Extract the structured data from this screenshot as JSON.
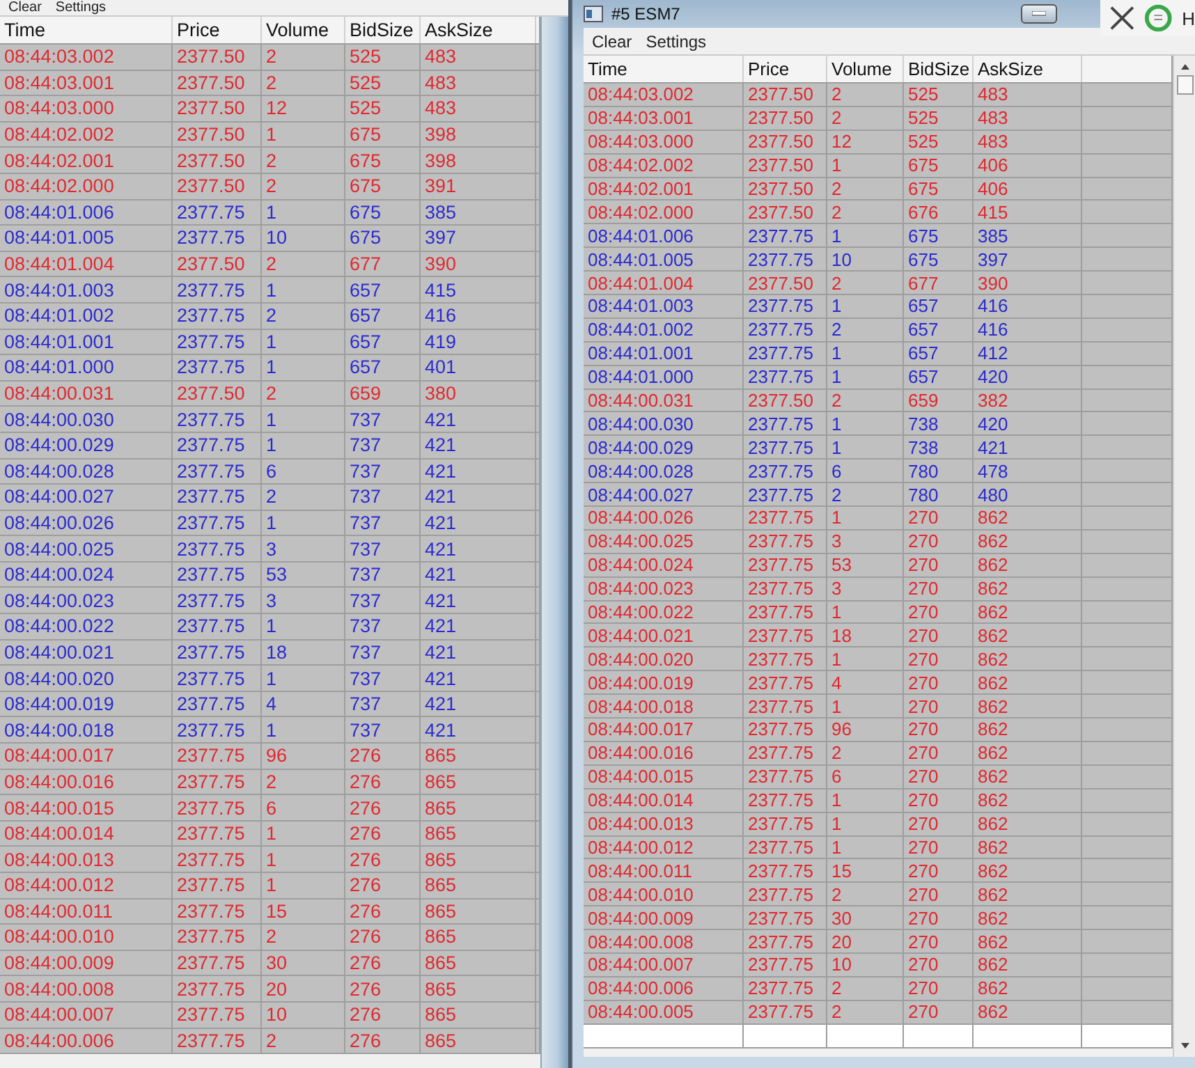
{
  "left_window": {
    "menu": [
      "Clear",
      "Settings"
    ],
    "columns": [
      "Time",
      "Price",
      "Volume",
      "BidSize",
      "AskSize"
    ],
    "rows": [
      {
        "cells": [
          "08:44:03.002",
          "2377.50",
          "2",
          "525",
          "483"
        ],
        "color": "#e0282e"
      },
      {
        "cells": [
          "08:44:03.001",
          "2377.50",
          "2",
          "525",
          "483"
        ],
        "color": "#e0282e"
      },
      {
        "cells": [
          "08:44:03.000",
          "2377.50",
          "12",
          "525",
          "483"
        ],
        "color": "#e0282e"
      },
      {
        "cells": [
          "08:44:02.002",
          "2377.50",
          "1",
          "675",
          "398"
        ],
        "color": "#e0282e"
      },
      {
        "cells": [
          "08:44:02.001",
          "2377.50",
          "2",
          "675",
          "398"
        ],
        "color": "#e0282e"
      },
      {
        "cells": [
          "08:44:02.000",
          "2377.50",
          "2",
          "675",
          "391"
        ],
        "color": "#e0282e"
      },
      {
        "cells": [
          "08:44:01.006",
          "2377.75",
          "1",
          "675",
          "385"
        ],
        "color": "#2a2ad0"
      },
      {
        "cells": [
          "08:44:01.005",
          "2377.75",
          "10",
          "675",
          "397"
        ],
        "color": "#2a2ad0"
      },
      {
        "cells": [
          "08:44:01.004",
          "2377.50",
          "2",
          "677",
          "390"
        ],
        "color": "#e0282e"
      },
      {
        "cells": [
          "08:44:01.003",
          "2377.75",
          "1",
          "657",
          "415"
        ],
        "color": "#2a2ad0"
      },
      {
        "cells": [
          "08:44:01.002",
          "2377.75",
          "2",
          "657",
          "416"
        ],
        "color": "#2a2ad0"
      },
      {
        "cells": [
          "08:44:01.001",
          "2377.75",
          "1",
          "657",
          "419"
        ],
        "color": "#2a2ad0"
      },
      {
        "cells": [
          "08:44:01.000",
          "2377.75",
          "1",
          "657",
          "401"
        ],
        "color": "#2a2ad0"
      },
      {
        "cells": [
          "08:44:00.031",
          "2377.50",
          "2",
          "659",
          "380"
        ],
        "color": "#e0282e"
      },
      {
        "cells": [
          "08:44:00.030",
          "2377.75",
          "1",
          "737",
          "421"
        ],
        "color": "#2a2ad0"
      },
      {
        "cells": [
          "08:44:00.029",
          "2377.75",
          "1",
          "737",
          "421"
        ],
        "color": "#2a2ad0"
      },
      {
        "cells": [
          "08:44:00.028",
          "2377.75",
          "6",
          "737",
          "421"
        ],
        "color": "#2a2ad0"
      },
      {
        "cells": [
          "08:44:00.027",
          "2377.75",
          "2",
          "737",
          "421"
        ],
        "color": "#2a2ad0"
      },
      {
        "cells": [
          "08:44:00.026",
          "2377.75",
          "1",
          "737",
          "421"
        ],
        "color": "#2a2ad0"
      },
      {
        "cells": [
          "08:44:00.025",
          "2377.75",
          "3",
          "737",
          "421"
        ],
        "color": "#2a2ad0"
      },
      {
        "cells": [
          "08:44:00.024",
          "2377.75",
          "53",
          "737",
          "421"
        ],
        "color": "#2a2ad0"
      },
      {
        "cells": [
          "08:44:00.023",
          "2377.75",
          "3",
          "737",
          "421"
        ],
        "color": "#2a2ad0"
      },
      {
        "cells": [
          "08:44:00.022",
          "2377.75",
          "1",
          "737",
          "421"
        ],
        "color": "#2a2ad0"
      },
      {
        "cells": [
          "08:44:00.021",
          "2377.75",
          "18",
          "737",
          "421"
        ],
        "color": "#2a2ad0"
      },
      {
        "cells": [
          "08:44:00.020",
          "2377.75",
          "1",
          "737",
          "421"
        ],
        "color": "#2a2ad0"
      },
      {
        "cells": [
          "08:44:00.019",
          "2377.75",
          "4",
          "737",
          "421"
        ],
        "color": "#2a2ad0"
      },
      {
        "cells": [
          "08:44:00.018",
          "2377.75",
          "1",
          "737",
          "421"
        ],
        "color": "#2a2ad0"
      },
      {
        "cells": [
          "08:44:00.017",
          "2377.75",
          "96",
          "276",
          "865"
        ],
        "color": "#e0282e"
      },
      {
        "cells": [
          "08:44:00.016",
          "2377.75",
          "2",
          "276",
          "865"
        ],
        "color": "#e0282e"
      },
      {
        "cells": [
          "08:44:00.015",
          "2377.75",
          "6",
          "276",
          "865"
        ],
        "color": "#e0282e"
      },
      {
        "cells": [
          "08:44:00.014",
          "2377.75",
          "1",
          "276",
          "865"
        ],
        "color": "#e0282e"
      },
      {
        "cells": [
          "08:44:00.013",
          "2377.75",
          "1",
          "276",
          "865"
        ],
        "color": "#e0282e"
      },
      {
        "cells": [
          "08:44:00.012",
          "2377.75",
          "1",
          "276",
          "865"
        ],
        "color": "#e0282e"
      },
      {
        "cells": [
          "08:44:00.011",
          "2377.75",
          "15",
          "276",
          "865"
        ],
        "color": "#e0282e"
      },
      {
        "cells": [
          "08:44:00.010",
          "2377.75",
          "2",
          "276",
          "865"
        ],
        "color": "#e0282e"
      },
      {
        "cells": [
          "08:44:00.009",
          "2377.75",
          "30",
          "276",
          "865"
        ],
        "color": "#e0282e"
      },
      {
        "cells": [
          "08:44:00.008",
          "2377.75",
          "20",
          "276",
          "865"
        ],
        "color": "#e0282e"
      },
      {
        "cells": [
          "08:44:00.007",
          "2377.75",
          "10",
          "276",
          "865"
        ],
        "color": "#e0282e"
      },
      {
        "cells": [
          "08:44:00.006",
          "2377.75",
          "2",
          "276",
          "865"
        ],
        "color": "#e0282e"
      }
    ]
  },
  "right_window": {
    "title": "#5 ESM7",
    "menu": [
      "Clear",
      "Settings"
    ],
    "columns": [
      "Time",
      "Price",
      "Volume",
      "BidSize",
      "AskSize"
    ],
    "rows": [
      {
        "cells": [
          "08:44:03.002",
          "2377.50",
          "2",
          "525",
          "483"
        ],
        "color": "#e0282e"
      },
      {
        "cells": [
          "08:44:03.001",
          "2377.50",
          "2",
          "525",
          "483"
        ],
        "color": "#e0282e"
      },
      {
        "cells": [
          "08:44:03.000",
          "2377.50",
          "12",
          "525",
          "483"
        ],
        "color": "#e0282e"
      },
      {
        "cells": [
          "08:44:02.002",
          "2377.50",
          "1",
          "675",
          "406"
        ],
        "color": "#e0282e"
      },
      {
        "cells": [
          "08:44:02.001",
          "2377.50",
          "2",
          "675",
          "406"
        ],
        "color": "#e0282e"
      },
      {
        "cells": [
          "08:44:02.000",
          "2377.50",
          "2",
          "676",
          "415"
        ],
        "color": "#e0282e"
      },
      {
        "cells": [
          "08:44:01.006",
          "2377.75",
          "1",
          "675",
          "385"
        ],
        "color": "#2a2ad0"
      },
      {
        "cells": [
          "08:44:01.005",
          "2377.75",
          "10",
          "675",
          "397"
        ],
        "color": "#2a2ad0"
      },
      {
        "cells": [
          "08:44:01.004",
          "2377.50",
          "2",
          "677",
          "390"
        ],
        "color": "#e0282e"
      },
      {
        "cells": [
          "08:44:01.003",
          "2377.75",
          "1",
          "657",
          "416"
        ],
        "color": "#2a2ad0"
      },
      {
        "cells": [
          "08:44:01.002",
          "2377.75",
          "2",
          "657",
          "416"
        ],
        "color": "#2a2ad0"
      },
      {
        "cells": [
          "08:44:01.001",
          "2377.75",
          "1",
          "657",
          "412"
        ],
        "color": "#2a2ad0"
      },
      {
        "cells": [
          "08:44:01.000",
          "2377.75",
          "1",
          "657",
          "420"
        ],
        "color": "#2a2ad0"
      },
      {
        "cells": [
          "08:44:00.031",
          "2377.50",
          "2",
          "659",
          "382"
        ],
        "color": "#e0282e"
      },
      {
        "cells": [
          "08:44:00.030",
          "2377.75",
          "1",
          "738",
          "420"
        ],
        "color": "#2a2ad0"
      },
      {
        "cells": [
          "08:44:00.029",
          "2377.75",
          "1",
          "738",
          "421"
        ],
        "color": "#2a2ad0"
      },
      {
        "cells": [
          "08:44:00.028",
          "2377.75",
          "6",
          "780",
          "478"
        ],
        "color": "#2a2ad0"
      },
      {
        "cells": [
          "08:44:00.027",
          "2377.75",
          "2",
          "780",
          "480"
        ],
        "color": "#2a2ad0"
      },
      {
        "cells": [
          "08:44:00.026",
          "2377.75",
          "1",
          "270",
          "862"
        ],
        "color": "#e0282e"
      },
      {
        "cells": [
          "08:44:00.025",
          "2377.75",
          "3",
          "270",
          "862"
        ],
        "color": "#e0282e"
      },
      {
        "cells": [
          "08:44:00.024",
          "2377.75",
          "53",
          "270",
          "862"
        ],
        "color": "#e0282e"
      },
      {
        "cells": [
          "08:44:00.023",
          "2377.75",
          "3",
          "270",
          "862"
        ],
        "color": "#e0282e"
      },
      {
        "cells": [
          "08:44:00.022",
          "2377.75",
          "1",
          "270",
          "862"
        ],
        "color": "#e0282e"
      },
      {
        "cells": [
          "08:44:00.021",
          "2377.75",
          "18",
          "270",
          "862"
        ],
        "color": "#e0282e"
      },
      {
        "cells": [
          "08:44:00.020",
          "2377.75",
          "1",
          "270",
          "862"
        ],
        "color": "#e0282e"
      },
      {
        "cells": [
          "08:44:00.019",
          "2377.75",
          "4",
          "270",
          "862"
        ],
        "color": "#e0282e"
      },
      {
        "cells": [
          "08:44:00.018",
          "2377.75",
          "1",
          "270",
          "862"
        ],
        "color": "#e0282e"
      },
      {
        "cells": [
          "08:44:00.017",
          "2377.75",
          "96",
          "270",
          "862"
        ],
        "color": "#e0282e"
      },
      {
        "cells": [
          "08:44:00.016",
          "2377.75",
          "2",
          "270",
          "862"
        ],
        "color": "#e0282e"
      },
      {
        "cells": [
          "08:44:00.015",
          "2377.75",
          "6",
          "270",
          "862"
        ],
        "color": "#e0282e"
      },
      {
        "cells": [
          "08:44:00.014",
          "2377.75",
          "1",
          "270",
          "862"
        ],
        "color": "#e0282e"
      },
      {
        "cells": [
          "08:44:00.013",
          "2377.75",
          "1",
          "270",
          "862"
        ],
        "color": "#e0282e"
      },
      {
        "cells": [
          "08:44:00.012",
          "2377.75",
          "1",
          "270",
          "862"
        ],
        "color": "#e0282e"
      },
      {
        "cells": [
          "08:44:00.011",
          "2377.75",
          "15",
          "270",
          "862"
        ],
        "color": "#e0282e"
      },
      {
        "cells": [
          "08:44:00.010",
          "2377.75",
          "2",
          "270",
          "862"
        ],
        "color": "#e0282e"
      },
      {
        "cells": [
          "08:44:00.009",
          "2377.75",
          "30",
          "270",
          "862"
        ],
        "color": "#e0282e"
      },
      {
        "cells": [
          "08:44:00.008",
          "2377.75",
          "20",
          "270",
          "862"
        ],
        "color": "#e0282e"
      },
      {
        "cells": [
          "08:44:00.007",
          "2377.75",
          "10",
          "270",
          "862"
        ],
        "color": "#e0282e"
      },
      {
        "cells": [
          "08:44:00.006",
          "2377.75",
          "2",
          "270",
          "862"
        ],
        "color": "#e0282e"
      },
      {
        "cells": [
          "08:44:00.005",
          "2377.75",
          "2",
          "270",
          "862"
        ],
        "color": "#e0282e"
      }
    ]
  },
  "corner_app": {
    "label": "H"
  }
}
